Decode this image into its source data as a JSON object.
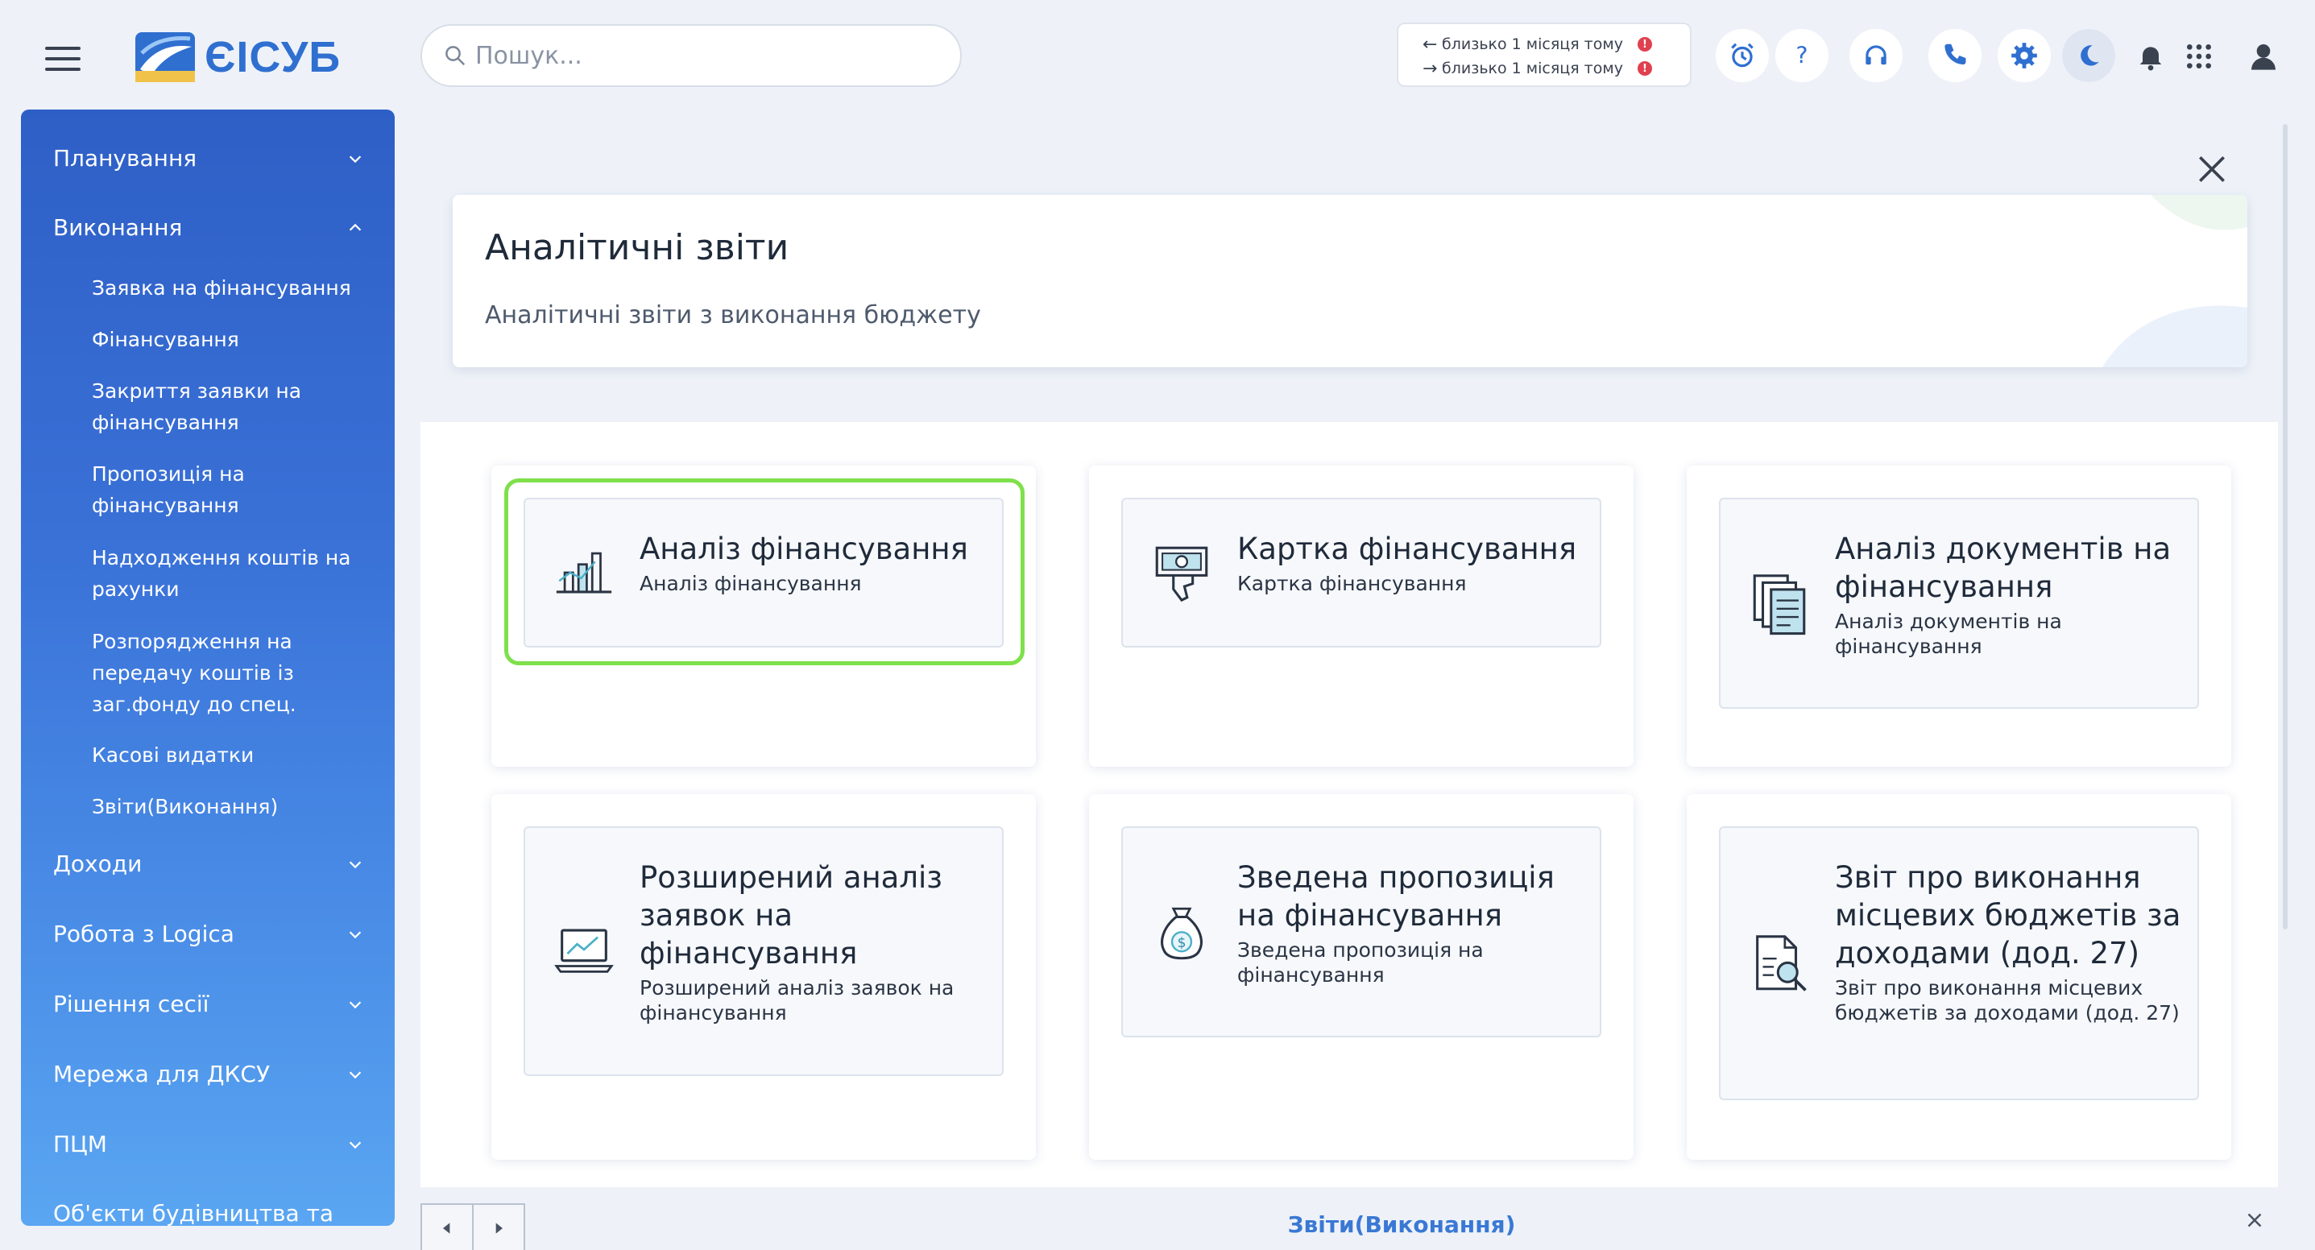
{
  "app": {
    "logo_text": "ЄІСУБ"
  },
  "search": {
    "placeholder": "Пошук..."
  },
  "sync": {
    "outgoing": "близько 1 місяця тому",
    "incoming": "близько 1 місяця тому"
  },
  "toolbar": {
    "icons": [
      "alarm-clock-icon",
      "help-icon",
      "support-headset-icon",
      "phone-icon",
      "gear-icon",
      "dark-mode-icon",
      "bell-icon",
      "apps-grid-icon",
      "user-icon"
    ]
  },
  "sidebar": {
    "items": [
      {
        "label": "Планування",
        "expanded": false
      },
      {
        "label": "Виконання",
        "expanded": true
      },
      {
        "label": "Доходи",
        "expanded": false
      },
      {
        "label": "Робота з Logica",
        "expanded": false
      },
      {
        "label": "Рішення сесії",
        "expanded": false
      },
      {
        "label": "Мережа для ДКСУ",
        "expanded": false
      },
      {
        "label": "ПЦМ",
        "expanded": false
      },
      {
        "label": "Об'єкти будівництва та",
        "expanded": false
      }
    ],
    "sub_items": [
      "Заявка на фінансування",
      "Фінансування",
      "Закриття заявки на фінансування",
      "Пропозиція на фінансування",
      "Надходження коштів на рахунки",
      "Розпорядження на передачу коштів із заг.фонду до спец.",
      "Касові видатки",
      "Звіти(Виконання)"
    ]
  },
  "header": {
    "title": "Аналітичні звіти",
    "subtitle": "Аналітичні звіти з виконання бюджету"
  },
  "reports": [
    {
      "title": "Аналіз фінансування",
      "desc": "Аналіз фінансування",
      "icon": "bar-chart-icon"
    },
    {
      "title": "Картка фінансування",
      "desc": "Картка фінансування",
      "icon": "money-hand-icon"
    },
    {
      "title": "Аналіз документів на фінансування",
      "desc": "Аналіз документів на фінансування",
      "icon": "documents-icon"
    },
    {
      "title": "Розширений аналіз заявок на фінансування",
      "desc": "Розширений аналіз заявок на фінансування",
      "icon": "laptop-chart-icon"
    },
    {
      "title": "Зведена пропозиція на фінансування",
      "desc": "Зведена пропозиція на фінансування",
      "icon": "money-bag-icon"
    },
    {
      "title": "Звіт про виконання місцевих бюджетів за доходами (дод. 27)",
      "desc": "Звіт про виконання місцевих бюджетів за доходами (дод. 27)",
      "icon": "document-search-icon"
    }
  ],
  "bottom": {
    "active_tab": "Звіти(Виконання)"
  }
}
